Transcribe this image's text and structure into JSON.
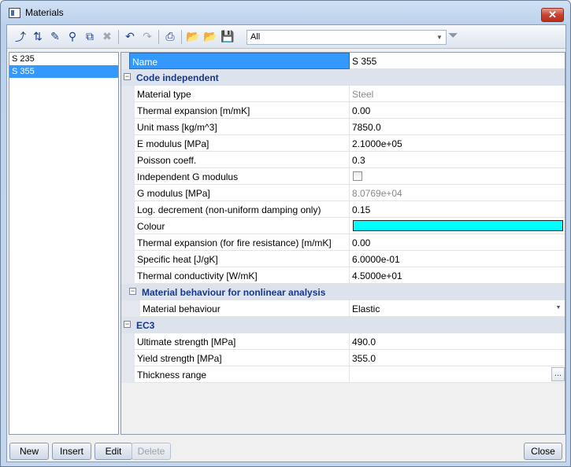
{
  "window": {
    "title": "Materials"
  },
  "toolbar": {
    "buttons": [
      {
        "icon": "import-icon"
      },
      {
        "icon": "sort-icon"
      },
      {
        "icon": "pencil-icon"
      },
      {
        "icon": "binoculars-icon"
      },
      {
        "icon": "copy-icon"
      },
      {
        "icon": "delete-icon",
        "disabled": true
      },
      {
        "icon": "undo-icon"
      },
      {
        "icon": "redo-icon",
        "disabled": true
      },
      {
        "icon": "print-icon"
      },
      {
        "icon": "open-folder-icon"
      },
      {
        "icon": "open-folder-alt-icon"
      },
      {
        "icon": "save-icon"
      }
    ],
    "filter_value": "All"
  },
  "materials": [
    {
      "label": "S 235",
      "selected": false
    },
    {
      "label": "S 355",
      "selected": true
    }
  ],
  "properties": {
    "header": {
      "name": "Name",
      "value": "S 355"
    },
    "sections": [
      {
        "title": "Code independent",
        "rows": [
          {
            "name": "Material type",
            "value": "Steel",
            "greyed": true
          },
          {
            "name": "Thermal expansion  [m/mK]",
            "value": "0.00"
          },
          {
            "name": "Unit mass [kg/m^3]",
            "value": "7850.0"
          },
          {
            "name": "E modulus [MPa]",
            "value": "2.1000e+05"
          },
          {
            "name": "Poisson coeff.",
            "value": "0.3"
          },
          {
            "name": "Independent G modulus",
            "value": "",
            "checkbox": false
          },
          {
            "name": "G modulus [MPa]",
            "value": "8.0769e+04",
            "greyed": true
          },
          {
            "name": "Log. decrement (non-uniform damping only)",
            "value": "0.15"
          },
          {
            "name": "Colour",
            "value": "",
            "swatch": "#00ffff"
          },
          {
            "name": "Thermal expansion (for fire resistance)  [m/mK]",
            "value": "0.00"
          },
          {
            "name": "Specific heat [J/gK]",
            "value": "6.0000e-01"
          },
          {
            "name": "Thermal conductivity [W/mK]",
            "value": "4.5000e+01"
          }
        ]
      },
      {
        "title": "Material behaviour for nonlinear analysis",
        "rows": [
          {
            "name": "Material behaviour",
            "value": "Elastic",
            "dropdown": true
          }
        ]
      },
      {
        "title": "EC3",
        "rows": [
          {
            "name": "Ultimate strength [MPa]",
            "value": "490.0"
          },
          {
            "name": "Yield strength [MPa]",
            "value": "355.0"
          },
          {
            "name": "Thickness range",
            "value": "",
            "ellipsis": "..."
          }
        ]
      }
    ]
  },
  "buttons": {
    "new": "New",
    "insert": "Insert",
    "edit": "Edit",
    "delete": "Delete",
    "close": "Close"
  },
  "colors": {
    "selection": "#3399ff",
    "section_text": "#17378a",
    "swatch": "#00ffff"
  }
}
